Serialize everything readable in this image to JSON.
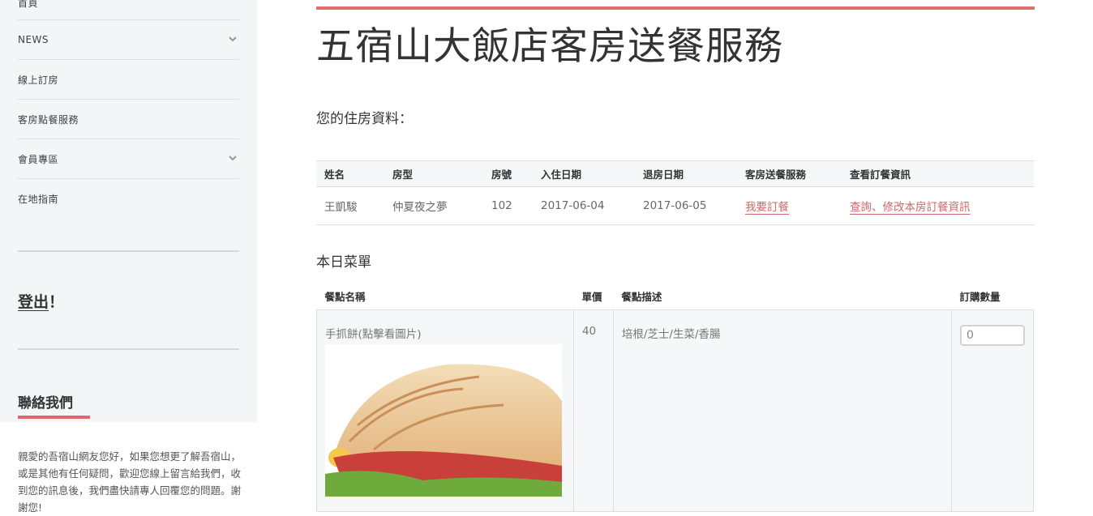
{
  "sidebar": {
    "items": [
      {
        "label": "首頁",
        "has_chevron": false
      },
      {
        "label": "NEWS",
        "has_chevron": true
      },
      {
        "label": "線上訂房",
        "has_chevron": false
      },
      {
        "label": "客房點餐服務",
        "has_chevron": false
      },
      {
        "label": "會員專區",
        "has_chevron": true
      },
      {
        "label": "在地指南",
        "has_chevron": false
      }
    ],
    "logout_label": "登出",
    "logout_suffix": "！",
    "contact_title": "聯絡我們",
    "contact_text": "親愛的吾宿山網友您好，如果您想更了解吾宿山，或是其他有任何疑問，歡迎您線上留言給我們，收到您的訊息後，我們盡快請專人回覆您的問題。謝謝您!"
  },
  "main": {
    "title": "五宿山大飯店客房送餐服務",
    "info_heading": "您的住房資料：",
    "info_table": {
      "headers": [
        "姓名",
        "房型",
        "房號",
        "入住日期",
        "退房日期",
        "客房送餐服務",
        "查看訂餐資訊"
      ],
      "row": {
        "name": "王凱駿",
        "room_type": "仲夏夜之夢",
        "room_no": "102",
        "checkin": "2017-06-04",
        "checkout": "2017-06-05",
        "order_link": "我要訂餐",
        "view_link": "查詢、修改本房訂餐資訊"
      }
    },
    "menu_heading": "本日菜單",
    "menu_table": {
      "headers": [
        "餐點名稱",
        "單價",
        "餐點描述",
        "訂購數量"
      ],
      "items": [
        {
          "name": "手抓餅(點擊看圖片)",
          "price": "40",
          "description": "培根/芝士/生菜/香腸",
          "qty": "0"
        }
      ]
    }
  },
  "colors": {
    "accent": "#e07070",
    "link": "#c96a6a",
    "sidebar_bg": "#f4f5f7"
  }
}
